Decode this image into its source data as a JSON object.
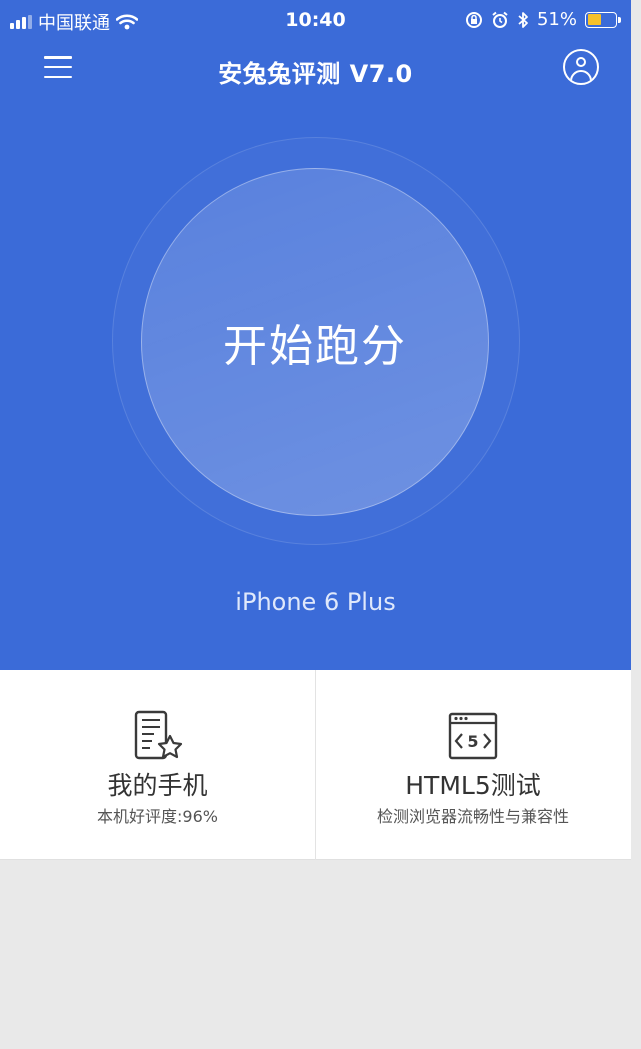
{
  "status_bar": {
    "carrier": "中国联通",
    "time": "10:40",
    "battery_percent": "51%",
    "battery_level": 0.51,
    "icons": [
      "signal-icon",
      "wifi-icon",
      "orientation-lock-icon",
      "alarm-icon",
      "bluetooth-icon",
      "battery-icon"
    ]
  },
  "nav": {
    "title": "安兔兔评测 V7.0",
    "menu_icon": "hamburger-menu-icon",
    "user_icon": "user-avatar-icon"
  },
  "main": {
    "start_button_label": "开始跑分",
    "device_name": "iPhone 6 Plus"
  },
  "cards": [
    {
      "title": "我的手机",
      "subtitle": "本机好评度:96%",
      "icon": "phone-star-icon"
    },
    {
      "title": "HTML5测试",
      "subtitle": "检测浏览器流畅性与兼容性",
      "icon": "html5-browser-icon"
    }
  ],
  "colors": {
    "primary_blue": "#3b6bd8",
    "background_gray": "#e9e9e9",
    "card_white": "#ffffff",
    "battery_yellow": "#f6c12a"
  }
}
